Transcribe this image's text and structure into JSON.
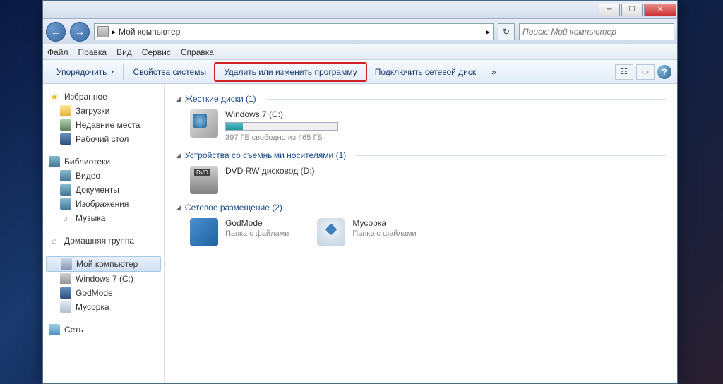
{
  "titlebar": {
    "min": "─",
    "max": "☐",
    "close": "✕"
  },
  "nav": {
    "back": "←",
    "fwd": "→",
    "path": "Мой компьютер",
    "sep": "▸",
    "refresh": "↻"
  },
  "search": {
    "placeholder": "Поиск: Мой компьютер",
    "icon": "🔍"
  },
  "menu": {
    "file": "Файл",
    "edit": "Правка",
    "view": "Вид",
    "service": "Сервис",
    "help": "Справка"
  },
  "toolbar": {
    "organize": "Упорядочить",
    "dd": "▾",
    "props": "Свойства системы",
    "uninstall": "Удалить или изменить программу",
    "netdrive": "Подключить сетевой диск",
    "more": "»",
    "view_icon": "☷",
    "pane_icon": "▭",
    "help": "?"
  },
  "sidebar": {
    "fav": "Избранное",
    "fav_items": [
      "Загрузки",
      "Недавние места",
      "Рабочий стол"
    ],
    "lib": "Библиотеки",
    "lib_items": [
      "Видео",
      "Документы",
      "Изображения",
      "Музыка"
    ],
    "home": "Домашняя группа",
    "comp": "Мой компьютер",
    "comp_items": [
      "Windows 7 (C:)",
      "GodMode",
      "Мусорка"
    ],
    "net": "Сеть"
  },
  "content": {
    "g1": "Жесткие диски (1)",
    "drive_name": "Windows 7 (C:)",
    "drive_free": "397 ГБ свободно из 465 ГБ",
    "drive_fill_pct": 15,
    "g2": "Устройства со съемными носителями (1)",
    "dvd_name": "DVD RW дисковод (D:)",
    "g3": "Сетевое размещение (2)",
    "god_name": "GodMode",
    "god_sub": "Папка с файлами",
    "bin_name": "Мусорка",
    "bin_sub": "Папка с файлами"
  }
}
